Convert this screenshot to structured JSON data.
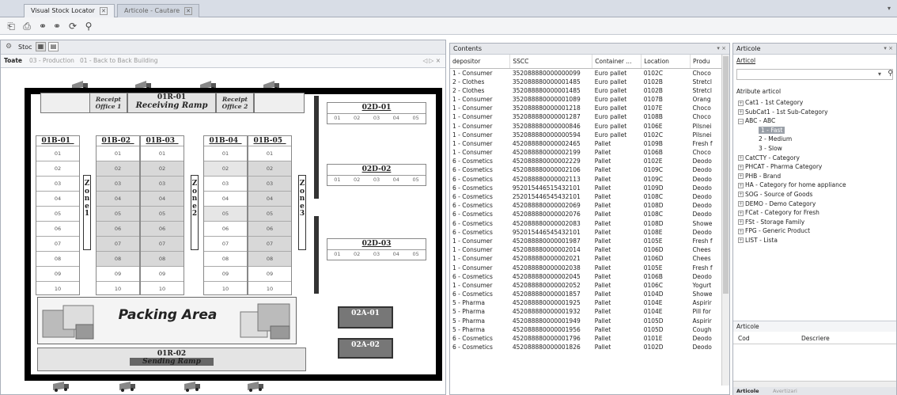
{
  "doc_tabs": [
    {
      "label": "Visual Stock Locator",
      "active": true
    },
    {
      "label": "Articole - Cautare",
      "active": false
    }
  ],
  "toolbar_icons": [
    "open-icon",
    "print-icon",
    "link-icon",
    "link2-icon",
    "refresh-icon",
    "search-icon"
  ],
  "left": {
    "header_label": "Stoc",
    "tabs": [
      "Toate",
      "03 - Production",
      "01 - Back to Back Building"
    ],
    "tab_nav": "◁ ▷ ×"
  },
  "map": {
    "receipt_office_1": "Receipt Office 1",
    "receipt_office_2": "Receipt Office 2",
    "receiving_code": "01R-01",
    "receiving_label": "Receiving Ramp",
    "sending_code": "01R-02",
    "sending_label": "Sending Ramp",
    "packing": "Packing Area",
    "racks": [
      {
        "name": "01B-01_",
        "cells": [
          "01",
          "02",
          "03",
          "04",
          "05",
          "06",
          "07",
          "08",
          "09",
          "10"
        ]
      },
      {
        "name": "01B-02_",
        "cells": [
          "01",
          "02",
          "03",
          "04",
          "05",
          "06",
          "07",
          "08",
          "09",
          "10"
        ]
      },
      {
        "name": "01B-03_",
        "cells": [
          "01",
          "02",
          "03",
          "04",
          "05",
          "06",
          "07",
          "08",
          "09",
          "10"
        ]
      },
      {
        "name": "01B-04_",
        "cells": [
          "01",
          "02",
          "03",
          "04",
          "05",
          "06",
          "07",
          "08",
          "09",
          "10"
        ]
      },
      {
        "name": "01B-05_",
        "cells": [
          "01",
          "02",
          "03",
          "04",
          "05",
          "06",
          "07",
          "08",
          "09",
          "10"
        ]
      }
    ],
    "zones": [
      {
        "label": "Z o n e 1"
      },
      {
        "label": "Z o n e 2"
      },
      {
        "label": "Z o n e 3"
      }
    ],
    "docks": [
      {
        "name": "02D-01",
        "cells": [
          "01",
          "02",
          "03",
          "04",
          "05"
        ]
      },
      {
        "name": "02D-02",
        "cells": [
          "01",
          "02",
          "03",
          "04",
          "05"
        ]
      },
      {
        "name": "02D-03",
        "cells": [
          "01",
          "02",
          "03",
          "04",
          "05"
        ]
      }
    ],
    "areas": [
      "02A-01",
      "02A-02"
    ]
  },
  "contents": {
    "title": "Contents",
    "controls": "▾ ×",
    "columns": [
      "depositor",
      "SSCC",
      "Container ...",
      "Location",
      "Produ"
    ],
    "rows": [
      [
        "1 - Consumer",
        "352088880000000099",
        "Euro pallet",
        "0102C",
        "Choco"
      ],
      [
        "2 - Clothes",
        "352088880000001485",
        "Euro pallet",
        "0102B",
        "Stretcl"
      ],
      [
        "2 - Clothes",
        "352088880000001485",
        "Euro pallet",
        "0102B",
        "Stretcl"
      ],
      [
        "1 - Consumer",
        "352088880000001089",
        "Euro pallet",
        "0107B",
        "Orang"
      ],
      [
        "1 - Consumer",
        "352088880000001218",
        "Euro pallet",
        "0107E",
        "Choco"
      ],
      [
        "1 - Consumer",
        "352088880000001287",
        "Euro pallet",
        "0108B",
        "Choco"
      ],
      [
        "1 - Consumer",
        "352088880000000846",
        "Euro pallet",
        "0106E",
        "Pilsnei"
      ],
      [
        "1 - Consumer",
        "352088880000000594",
        "Euro pallet",
        "0102C",
        "Pilsnei"
      ],
      [
        "1 - Consumer",
        "452088880000002465",
        "Pallet",
        "0109B",
        "Fresh f"
      ],
      [
        "1 - Consumer",
        "452088880000002199",
        "Pallet",
        "0106B",
        "Choco"
      ],
      [
        "6 - Cosmetics",
        "452088880000002229",
        "Pallet",
        "0102E",
        "Deodo"
      ],
      [
        "6 - Cosmetics",
        "452088880000002106",
        "Pallet",
        "0109C",
        "Deodo"
      ],
      [
        "6 - Cosmetics",
        "452088880000002113",
        "Pallet",
        "0109C",
        "Deodo"
      ],
      [
        "6 - Cosmetics",
        "952015446515432101",
        "Pallet",
        "0109D",
        "Deodo"
      ],
      [
        "6 - Cosmetics",
        "252015446545432101",
        "Pallet",
        "0108C",
        "Deodo"
      ],
      [
        "6 - Cosmetics",
        "452088880000002069",
        "Pallet",
        "0108D",
        "Deodo"
      ],
      [
        "6 - Cosmetics",
        "452088880000002076",
        "Pallet",
        "0108C",
        "Deodo"
      ],
      [
        "6 - Cosmetics",
        "452088880000002083",
        "Pallet",
        "0108D",
        "Showe"
      ],
      [
        "6 - Cosmetics",
        "952015446545432101",
        "Pallet",
        "0108E",
        "Deodo"
      ],
      [
        "1 - Consumer",
        "452088880000001987",
        "Pallet",
        "0105E",
        "Fresh f"
      ],
      [
        "1 - Consumer",
        "452088880000002014",
        "Pallet",
        "0106D",
        "Chees"
      ],
      [
        "1 - Consumer",
        "452088880000002021",
        "Pallet",
        "0106D",
        "Chees"
      ],
      [
        "1 - Consumer",
        "452088880000002038",
        "Pallet",
        "0105E",
        "Fresh f"
      ],
      [
        "6 - Cosmetics",
        "452088880000002045",
        "Pallet",
        "0106B",
        "Deodo"
      ],
      [
        "1 - Consumer",
        "452088880000002052",
        "Pallet",
        "0106C",
        "Yogurt"
      ],
      [
        "6 - Cosmetics",
        "452088880000001857",
        "Pallet",
        "0104D",
        "Showe"
      ],
      [
        "5 - Pharma",
        "452088880000001925",
        "Pallet",
        "0104E",
        "Aspirir"
      ],
      [
        "5 - Pharma",
        "452088880000001932",
        "Pallet",
        "0104E",
        "Pill for"
      ],
      [
        "5 - Pharma",
        "452088880000001949",
        "Pallet",
        "0105D",
        "Aspirir"
      ],
      [
        "5 - Pharma",
        "452088880000001956",
        "Pallet",
        "0105D",
        "Cough"
      ],
      [
        "6 - Cosmetics",
        "452088880000001796",
        "Pallet",
        "0101E",
        "Deodo"
      ],
      [
        "6 - Cosmetics",
        "452088880000001826",
        "Pallet",
        "0102D",
        "Deodo"
      ]
    ]
  },
  "articole": {
    "title": "Articole",
    "controls": "▾ ×",
    "field_label": "Articol",
    "section_label": "Atribute articol",
    "tree": [
      {
        "level": 1,
        "label": "Cat1 - 1st Category",
        "expander": "+"
      },
      {
        "level": 1,
        "label": "SubCat1 - 1st Sub-Category",
        "expander": "+"
      },
      {
        "level": 1,
        "label": "ABC - ABC",
        "expander": "−"
      },
      {
        "level": 3,
        "label": "1 - Fast",
        "expander": "",
        "selected": true
      },
      {
        "level": 3,
        "label": "2 - Medium",
        "expander": ""
      },
      {
        "level": 3,
        "label": "3 - Slow",
        "expander": ""
      },
      {
        "level": 1,
        "label": "CatCTY - Category",
        "expander": "+"
      },
      {
        "level": 1,
        "label": "PHCAT - Pharma Category",
        "expander": "+"
      },
      {
        "level": 1,
        "label": "PHB - Brand",
        "expander": "+"
      },
      {
        "level": 1,
        "label": "HA - Category for home appliance",
        "expander": "+"
      },
      {
        "level": 1,
        "label": "SOG - Source of Goods",
        "expander": "+"
      },
      {
        "level": 1,
        "label": "DEMO - Demo Category",
        "expander": "+"
      },
      {
        "level": 1,
        "label": "FCat - Category for Fresh",
        "expander": "+"
      },
      {
        "level": 1,
        "label": "FSt - Storage Family",
        "expander": "+"
      },
      {
        "level": 1,
        "label": "FPG - Generic Product",
        "expander": "+"
      },
      {
        "level": 1,
        "label": "LIST - Lista",
        "expander": "+"
      }
    ],
    "list_title": "Articole",
    "list_columns": [
      "Cod",
      "Descriere"
    ],
    "bottom_tabs": [
      "Articole",
      "Avertizari"
    ]
  }
}
